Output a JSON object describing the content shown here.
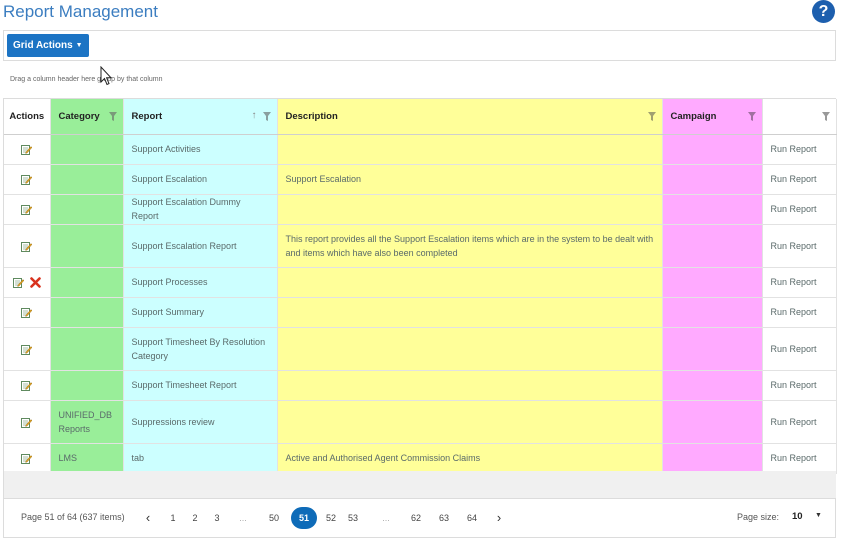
{
  "page": {
    "title": "Report Management",
    "help_label": "?"
  },
  "toolbar": {
    "grid_actions_label": "Grid Actions"
  },
  "grid": {
    "group_hint_before": "Drag a column header here",
    "group_hint_after": " group by that column",
    "columns": [
      {
        "key": "actions",
        "label": "Actions"
      },
      {
        "key": "category",
        "label": "Category"
      },
      {
        "key": "report",
        "label": "Report"
      },
      {
        "key": "description",
        "label": "Description"
      },
      {
        "key": "campaign",
        "label": "Campaign"
      },
      {
        "key": "run",
        "label": ""
      }
    ],
    "sort_glyph": "↑",
    "rows": [
      {
        "category": "",
        "report": "Support Activities",
        "description": "",
        "campaign": "",
        "run": "Run Report",
        "deletable": false
      },
      {
        "category": "",
        "report": "Support Escalation",
        "description": "Support Escalation",
        "campaign": "",
        "run": "Run Report",
        "deletable": false
      },
      {
        "category": "",
        "report": "Support Escalation Dummy Report",
        "description": "",
        "campaign": "",
        "run": "Run Report",
        "deletable": false
      },
      {
        "category": "",
        "report": "Support Escalation Report",
        "description": "This report provides all the Support Escalation items which are in the system to be dealt with and items which have also been completed",
        "campaign": "",
        "run": "Run Report",
        "deletable": false
      },
      {
        "category": "",
        "report": "Support Processes",
        "description": "",
        "campaign": "",
        "run": "Run Report",
        "deletable": true
      },
      {
        "category": "",
        "report": "Support Summary",
        "description": "",
        "campaign": "",
        "run": "Run Report",
        "deletable": false
      },
      {
        "category": "",
        "report": "Support Timesheet By Resolution Category",
        "description": "",
        "campaign": "",
        "run": "Run Report",
        "deletable": false
      },
      {
        "category": "",
        "report": "Support Timesheet Report",
        "description": "",
        "campaign": "",
        "run": "Run Report",
        "deletable": false
      },
      {
        "category": "UNIFIED_DB Reports",
        "report": "Suppressions review",
        "description": "",
        "campaign": "",
        "run": "Run Report",
        "deletable": false
      },
      {
        "category": "LMS",
        "report": "tab",
        "description": "Active and Authorised Agent Commission Claims",
        "campaign": "",
        "run": "Run Report",
        "deletable": false
      }
    ]
  },
  "pager": {
    "info": "Page 51 of 64 (637 items)",
    "prev": "‹",
    "next": "›",
    "items": [
      "1",
      "2",
      "3",
      "...",
      "50",
      "51",
      "52",
      "53",
      "...",
      "62",
      "63",
      "64"
    ],
    "current": "51",
    "page_size_label": "Page size:",
    "page_size_value": "10",
    "page_size_caret": "▼"
  },
  "colors": {
    "category": "#99ee99",
    "report": "#ccffff",
    "description": "#ffff99",
    "campaign": "#ffaaff",
    "accent": "#1c74c4"
  },
  "icons": {
    "help": "help-icon",
    "edit": "edit-icon",
    "delete": "delete-icon",
    "filter": "filter-icon",
    "cursor": "mouse-cursor-icon"
  }
}
